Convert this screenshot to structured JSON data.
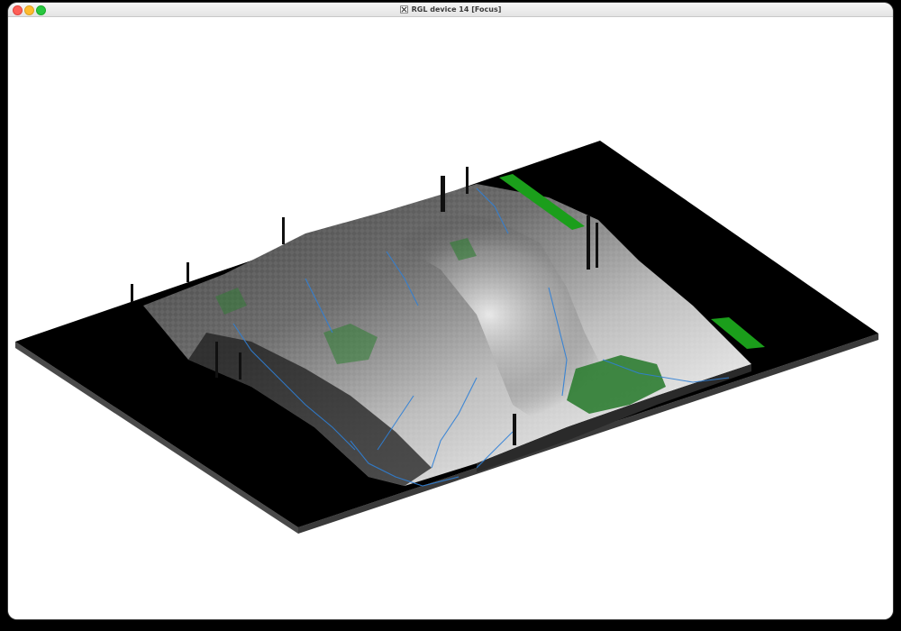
{
  "window": {
    "title": "RGL device 14 [Focus]",
    "app_icon": "x11-icon",
    "controls": [
      "close",
      "minimize",
      "zoom"
    ]
  },
  "scene": {
    "description_type": "3D rendered terrain relief",
    "background_color": "#ffffff",
    "base_color": "#000000",
    "base_edge_color": "#4a4a4a",
    "terrain_shade_colors": [
      "#202020",
      "#555555",
      "#8a8a8a",
      "#c8c8c8",
      "#ececec"
    ],
    "water_color": "#2f7fd6",
    "vegetation_color": "#2e7d32",
    "highlight_vegetation_color": "#1b9e1b"
  }
}
